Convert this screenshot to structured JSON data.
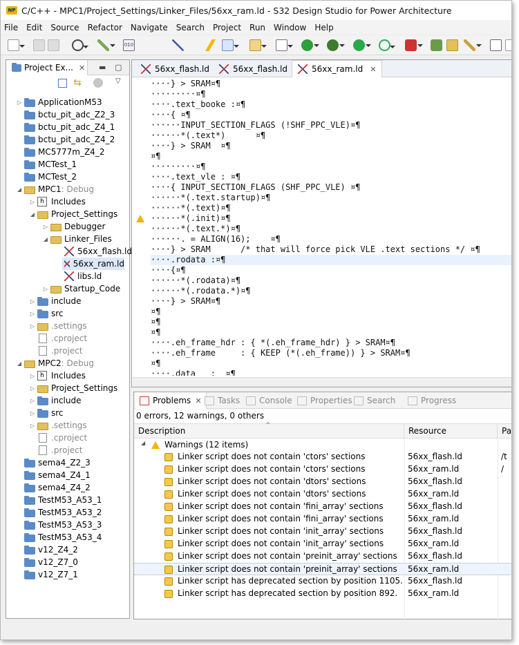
{
  "window_title": "C/C++ - MPC1/Project_Settings/Linker_Files/56xx_ram.ld - S32 Design Studio for Power Architecture",
  "menu": [
    "File",
    "Edit",
    "Source",
    "Refactor",
    "Navigate",
    "Search",
    "Project",
    "Run",
    "Window",
    "Help"
  ],
  "project_explorer": {
    "tab_label": "Project Ex...",
    "items": [
      {
        "label": "ApplicationM53",
        "suffix": "",
        "depth": 0,
        "icon": "folder-icon",
        "twisty": "collapsed"
      },
      {
        "label": "bctu_pit_adc_Z2_3",
        "suffix": "",
        "depth": 0,
        "icon": "folder-icon",
        "twisty": ""
      },
      {
        "label": "bctu_pit_adc_Z4_1",
        "suffix": "",
        "depth": 0,
        "icon": "folder-icon",
        "twisty": ""
      },
      {
        "label": "bctu_pit_adc_Z4_2",
        "suffix": "",
        "depth": 0,
        "icon": "folder-icon",
        "twisty": ""
      },
      {
        "label": "MC5777m_Z4_2",
        "suffix": "",
        "depth": 0,
        "icon": "folder-icon",
        "twisty": ""
      },
      {
        "label": "MCTest_1",
        "suffix": "",
        "depth": 0,
        "icon": "folder-icon",
        "twisty": ""
      },
      {
        "label": "MCTest_2",
        "suffix": "",
        "depth": 0,
        "icon": "folder-icon",
        "twisty": ""
      },
      {
        "label": "MPC1",
        "suffix": ": Debug",
        "depth": 0,
        "icon": "open-project-icon",
        "twisty": "expanded"
      },
      {
        "label": "Includes",
        "suffix": "",
        "depth": 1,
        "icon": "includes-icon",
        "twisty": "collapsed"
      },
      {
        "label": "Project_Settings",
        "suffix": "",
        "depth": 1,
        "icon": "open-folder-icon",
        "twisty": "expanded"
      },
      {
        "label": "Debugger",
        "suffix": "",
        "depth": 2,
        "icon": "yellow-folder-icon",
        "twisty": "collapsed"
      },
      {
        "label": "Linker_Files",
        "suffix": "",
        "depth": 2,
        "icon": "open-folder-icon",
        "twisty": "expanded"
      },
      {
        "label": "56xx_flash.ld",
        "suffix": "",
        "depth": 3,
        "icon": "linker-file-icon",
        "twisty": ""
      },
      {
        "label": "56xx_ram.ld",
        "suffix": "",
        "depth": 3,
        "icon": "linker-file-icon",
        "twisty": "",
        "selected": true
      },
      {
        "label": "libs.ld",
        "suffix": "",
        "depth": 3,
        "icon": "linker-file-icon",
        "twisty": ""
      },
      {
        "label": "Startup_Code",
        "suffix": "",
        "depth": 2,
        "icon": "yellow-folder-icon",
        "twisty": "collapsed"
      },
      {
        "label": "include",
        "suffix": "",
        "depth": 1,
        "icon": "folder-icon",
        "twisty": "collapsed"
      },
      {
        "label": "src",
        "suffix": "",
        "depth": 1,
        "icon": "folder-icon",
        "twisty": "collapsed"
      },
      {
        "label": ".settings",
        "suffix": "",
        "depth": 1,
        "icon": "yellow-folder-icon",
        "twisty": "collapsed",
        "gray": true
      },
      {
        "label": ".cproject",
        "suffix": "",
        "depth": 1,
        "icon": "file-icon",
        "twisty": "",
        "gray": true
      },
      {
        "label": ".project",
        "suffix": "",
        "depth": 1,
        "icon": "file-icon",
        "twisty": "",
        "gray": true
      },
      {
        "label": "MPC2",
        "suffix": ": Debug",
        "depth": 0,
        "icon": "open-project-icon",
        "twisty": "expanded"
      },
      {
        "label": "Includes",
        "suffix": "",
        "depth": 1,
        "icon": "includes-icon",
        "twisty": "collapsed"
      },
      {
        "label": "Project_Settings",
        "suffix": "",
        "depth": 1,
        "icon": "yellow-folder-icon",
        "twisty": "collapsed"
      },
      {
        "label": "include",
        "suffix": "",
        "depth": 1,
        "icon": "folder-icon",
        "twisty": "collapsed"
      },
      {
        "label": "src",
        "suffix": "",
        "depth": 1,
        "icon": "folder-icon",
        "twisty": "collapsed"
      },
      {
        "label": ".settings",
        "suffix": "",
        "depth": 1,
        "icon": "yellow-folder-icon",
        "twisty": "collapsed",
        "gray": true
      },
      {
        "label": ".cproject",
        "suffix": "",
        "depth": 1,
        "icon": "file-icon",
        "twisty": "",
        "gray": true
      },
      {
        "label": ".project",
        "suffix": "",
        "depth": 1,
        "icon": "file-icon",
        "twisty": "",
        "gray": true
      },
      {
        "label": "sema4_Z2_3",
        "suffix": "",
        "depth": 0,
        "icon": "folder-icon",
        "twisty": ""
      },
      {
        "label": "sema4_Z4_1",
        "suffix": "",
        "depth": 0,
        "icon": "folder-icon",
        "twisty": ""
      },
      {
        "label": "sema4_Z4_2",
        "suffix": "",
        "depth": 0,
        "icon": "folder-icon",
        "twisty": ""
      },
      {
        "label": "TestM53_A53_1",
        "suffix": "",
        "depth": 0,
        "icon": "folder-icon",
        "twisty": ""
      },
      {
        "label": "TestM53_A53_2",
        "suffix": "",
        "depth": 0,
        "icon": "folder-icon",
        "twisty": ""
      },
      {
        "label": "TestM53_A53_3",
        "suffix": "",
        "depth": 0,
        "icon": "folder-icon",
        "twisty": ""
      },
      {
        "label": "TestM53_A53_4",
        "suffix": "",
        "depth": 0,
        "icon": "folder-icon",
        "twisty": ""
      },
      {
        "label": "v12_Z4_2",
        "suffix": "",
        "depth": 0,
        "icon": "folder-icon",
        "twisty": ""
      },
      {
        "label": "v12_Z7_0",
        "suffix": "",
        "depth": 0,
        "icon": "folder-icon",
        "twisty": ""
      },
      {
        "label": "v12_Z7_1",
        "suffix": "",
        "depth": 0,
        "icon": "folder-icon",
        "twisty": ""
      }
    ]
  },
  "editor": {
    "tabs": [
      {
        "label": "56xx_flash.ld",
        "active": false
      },
      {
        "label": "56xx_flash.ld",
        "active": false
      },
      {
        "label": "56xx_ram.ld",
        "active": true
      }
    ],
    "lines": [
      "····} > SRAM¤¶",
      "·········¤¶",
      "····.text_booke :¤¶",
      "····{ ¤¶",
      "······INPUT_SECTION_FLAGS (!SHF_PPC_VLE)¤¶",
      "······*(.text*)      ¤¶",
      "····} > SRAM  ¤¶",
      "¤¶",
      "·········¤¶",
      "····.text_vle : ¤¶",
      "····{ INPUT_SECTION_FLAGS (SHF_PPC_VLE) ¤¶",
      "······*(.text.startup)¤¶",
      "······*(.text)¤¶",
      "······*(.init)¤¶",
      "······*(.text.*)¤¶",
      "······. = ALIGN(16);    ¤¶",
      "····} > SRAM      /* that will force pick VLE .text sections */ ¤¶",
      "····.rodata :¤¶",
      "····{¤¶",
      "······*(.rodata)¤¶",
      "······*(.rodata.*)¤¶",
      "····} > SRAM¤¶",
      "¤¶",
      "¤¶",
      "¤¶",
      "····.eh_frame_hdr : { *(.eh_frame_hdr) } > SRAM¤¶",
      "····.eh_frame     : { KEEP (*(.eh_frame)) } > SRAM¤¶",
      "¤¶",
      "····.data   :  ¤¶"
    ],
    "highlight_line": 17
  },
  "bottom": {
    "tabs": [
      "Problems",
      "Tasks",
      "Console",
      "Properties",
      "Search",
      "Progress"
    ],
    "summary": "0 errors, 12 warnings, 0 others",
    "columns": [
      "Description",
      "Resource",
      "Pa"
    ],
    "group": "Warnings (12 items)",
    "warnings": [
      {
        "d": "Linker script does not contain 'ctors' sections",
        "r": "56xx_flash.ld",
        "p": "/t"
      },
      {
        "d": "Linker script does not contain 'ctors' sections",
        "r": "56xx_ram.ld",
        "p": "/"
      },
      {
        "d": "Linker script does not contain 'dtors' sections",
        "r": "56xx_flash.ld",
        "p": ""
      },
      {
        "d": "Linker script does not contain 'dtors' sections",
        "r": "56xx_ram.ld",
        "p": ""
      },
      {
        "d": "Linker script does not contain 'fini_array' sections",
        "r": "56xx_flash.ld",
        "p": ""
      },
      {
        "d": "Linker script does not contain 'fini_array' sections",
        "r": "56xx_ram.ld",
        "p": ""
      },
      {
        "d": "Linker script does not contain 'init_array' sections",
        "r": "56xx_flash.ld",
        "p": ""
      },
      {
        "d": "Linker script does not contain 'init_array' sections",
        "r": "56xx_ram.ld",
        "p": ""
      },
      {
        "d": "Linker script does not contain 'preinit_array' sections",
        "r": "56xx_flash.ld",
        "p": ""
      },
      {
        "d": "Linker script does not contain 'preinit_array' sections",
        "r": "56xx_ram.ld",
        "p": ""
      },
      {
        "d": "Linker script has deprecated section by position 1105.",
        "r": "56xx_flash.ld",
        "p": ""
      },
      {
        "d": "Linker script has deprecated section by position 892.",
        "r": "56xx_ram.ld",
        "p": ""
      }
    ],
    "selected_row": 9
  }
}
